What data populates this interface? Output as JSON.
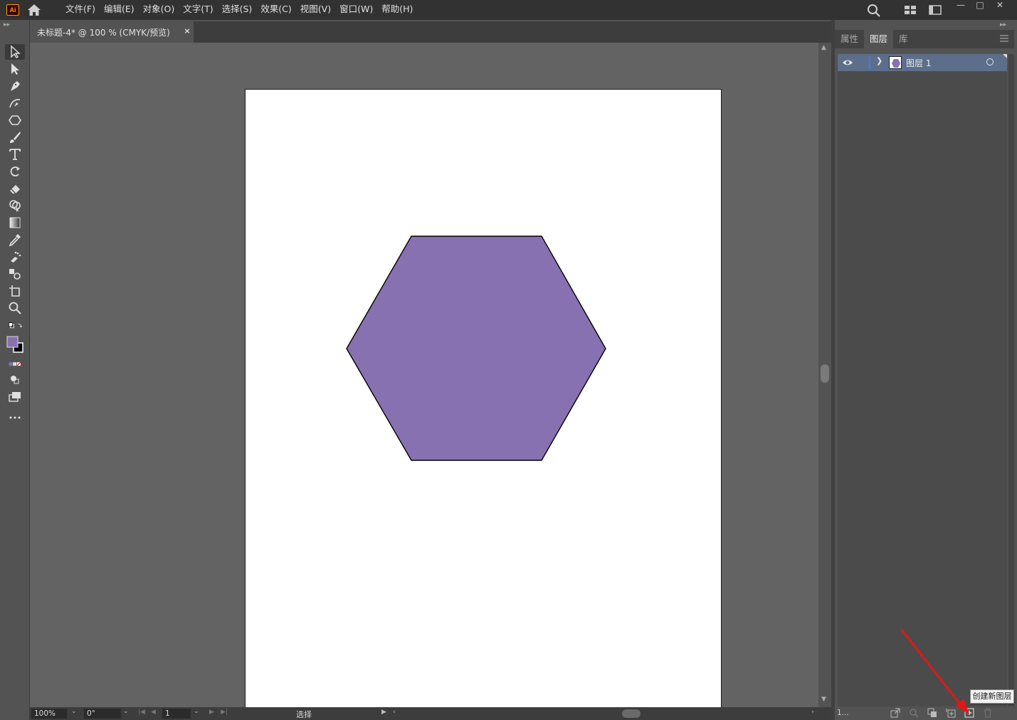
{
  "app": {
    "logo_text": "Ai"
  },
  "menu": {
    "items": [
      "文件(F)",
      "编辑(E)",
      "对象(O)",
      "文字(T)",
      "选择(S)",
      "效果(C)",
      "视图(V)",
      "窗口(W)",
      "帮助(H)"
    ]
  },
  "document": {
    "tab_title": "未标题-4* @ 100 % (CMYK/预览)",
    "close_glyph": "×"
  },
  "shape": {
    "type": "hexagon",
    "fill": "#8771b1",
    "stroke": "#000000"
  },
  "status_bar": {
    "zoom": "100%",
    "rotation": "0°",
    "artboard_number": "1",
    "current_tool": "选择"
  },
  "panel": {
    "tabs": [
      "属性",
      "图层",
      "库"
    ],
    "active_tab": "图层",
    "layers": [
      {
        "name": "图层 1",
        "color": "#3c7bff"
      }
    ],
    "layer_count": "1...",
    "tooltip": "创建新图层"
  },
  "colors": {
    "fill_swatch": "#8771b1",
    "selection_row": "#5d6e8a",
    "annotation_arrow": "#e01818"
  },
  "icons": [
    "selection-tool-icon",
    "direct-selection-tool-icon",
    "pen-tool-icon",
    "curvature-tool-icon",
    "polygon-tool-icon",
    "paintbrush-tool-icon",
    "type-tool-icon",
    "rotate-tool-icon",
    "eraser-tool-icon",
    "shape-builder-tool-icon",
    "gradient-tool-icon",
    "eyedropper-tool-icon",
    "symbol-sprayer-tool-icon",
    "blend-tool-icon",
    "artboard-tool-icon",
    "zoom-tool-icon",
    "eye-icon",
    "new-layer-icon",
    "trash-icon"
  ]
}
